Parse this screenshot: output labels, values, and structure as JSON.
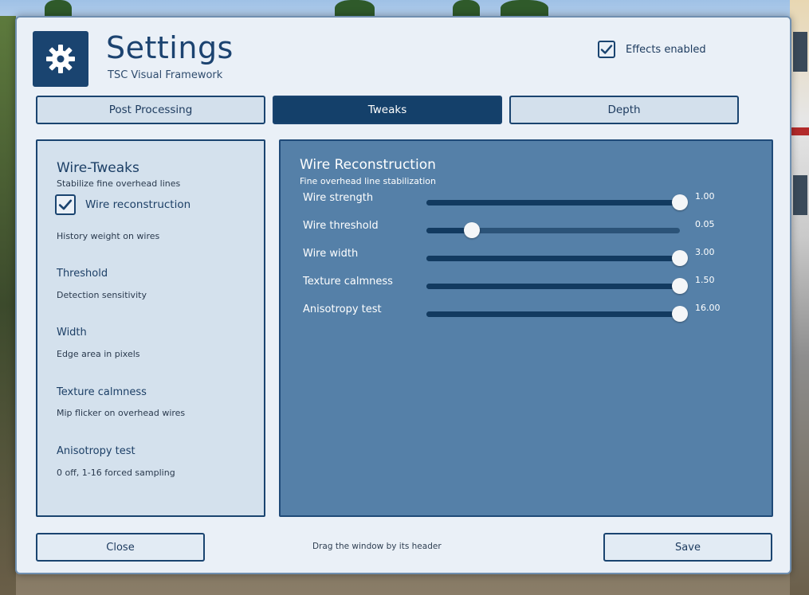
{
  "app": {
    "title": "Settings",
    "subtitle": "TSC Visual Framework",
    "logo_icon": "gear-icon",
    "effects_toggle": {
      "label": "Effects enabled",
      "checked": true
    }
  },
  "tabs": [
    {
      "label": "Post Processing",
      "active": false
    },
    {
      "label": "Tweaks",
      "active": true
    },
    {
      "label": "Depth",
      "active": false
    }
  ],
  "left_panel": {
    "title": "Wire-Tweaks",
    "subtitle": "Stabilize fine overhead lines",
    "wire_reconstruction": {
      "label": "Wire reconstruction",
      "checked": true
    },
    "history_desc": "History weight on wires",
    "items": [
      {
        "heading": "Threshold",
        "desc": "Detection sensitivity"
      },
      {
        "heading": "Width",
        "desc": "Edge area in pixels"
      },
      {
        "heading": "Texture calmness",
        "desc": "Mip flicker on overhead wires"
      },
      {
        "heading": "Anisotropy test",
        "desc": "0 off, 1-16 forced sampling"
      }
    ]
  },
  "right_panel": {
    "title": "Wire Reconstruction",
    "subtitle": "Fine overhead line stabilization",
    "sliders": [
      {
        "label": "Wire strength",
        "value": "1.00",
        "fraction": 1.0
      },
      {
        "label": "Wire threshold",
        "value": "0.05",
        "fraction": 0.18
      },
      {
        "label": "Wire width",
        "value": "3.00",
        "fraction": 1.0
      },
      {
        "label": "Texture calmness",
        "value": "1.50",
        "fraction": 1.0
      },
      {
        "label": "Anisotropy test",
        "value": "16.00",
        "fraction": 1.0
      }
    ]
  },
  "footer": {
    "close_label": "Close",
    "hint": "Drag the window by its header",
    "save_label": "Save"
  },
  "colors": {
    "accent": "#1a4470",
    "active_tab": "#14406a",
    "panel_blue": "#5580a8",
    "panel_light": "#d4e1ed"
  }
}
